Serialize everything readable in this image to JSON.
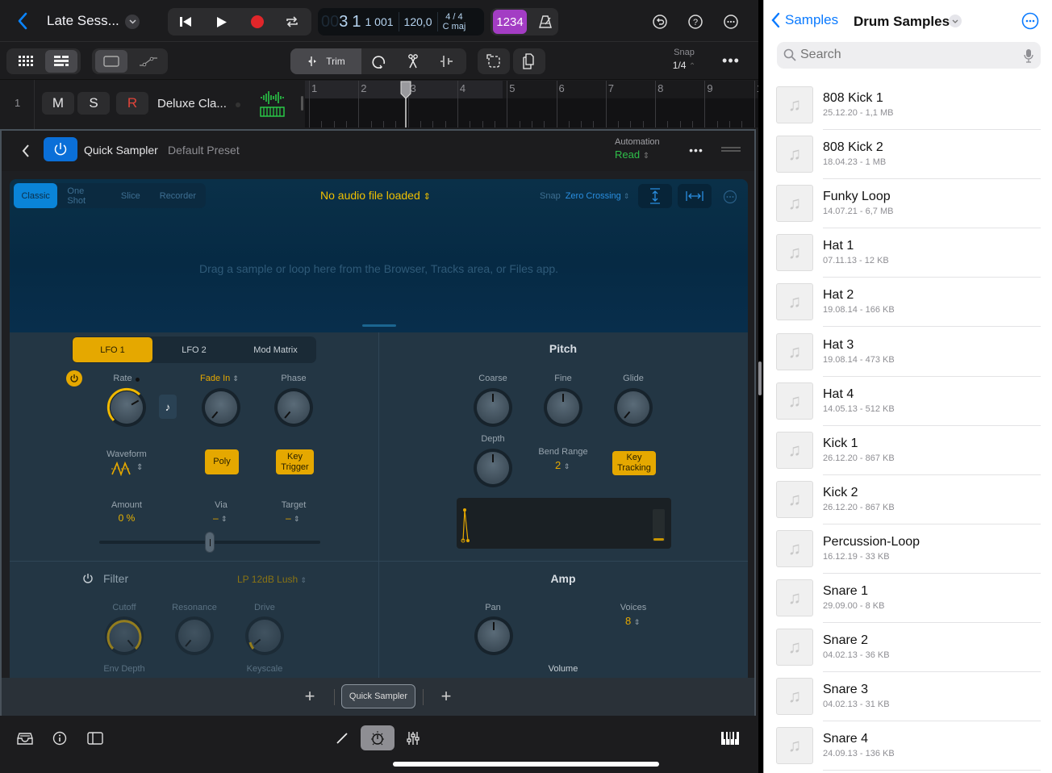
{
  "topbar": {
    "project_title": "Late Sess...",
    "lcd": {
      "position_dim": "00",
      "bar": "3",
      "beat": "1",
      "ticks": "1 001",
      "tempo": "120,0",
      "time_signature": "4 / 4",
      "key": "C maj"
    },
    "count_in_label": "1234",
    "accent_purple": "#a33dc4"
  },
  "toolbar": {
    "trim_label": "Trim",
    "snap_label": "Snap",
    "snap_value": "1/4"
  },
  "track": {
    "number": "1",
    "mute_label": "M",
    "solo_label": "S",
    "record_label": "R",
    "name": "Deluxe Cla...",
    "ruler_bars": [
      "1",
      "2",
      "3",
      "4",
      "5",
      "6",
      "7",
      "8",
      "9",
      "1"
    ],
    "playhead_bar": 2.95
  },
  "plugin": {
    "name": "Quick Sampler",
    "preset": "Default Preset",
    "automation_label": "Automation",
    "automation_value": "Read",
    "modes": [
      "Classic",
      "One Shot",
      "Slice",
      "Recorder"
    ],
    "active_mode": "Classic",
    "audio_file": "No audio file loaded",
    "snap_label": "Snap",
    "snap_value": "Zero Crossing",
    "drop_hint": "Drag a sample or loop here from the Browser, Tracks area, or Files app.",
    "mod_tabs": [
      "LFO 1",
      "LFO 2",
      "Mod Matrix"
    ],
    "active_mod_tab": "LFO 1",
    "lfo": {
      "rate_label": "Rate",
      "fade_label": "Fade In",
      "phase_label": "Phase",
      "waveform_label": "Waveform",
      "poly_label": "Poly",
      "key_trigger_label": "Key Trigger",
      "amount_label": "Amount",
      "amount_value": "0 %",
      "via_label": "Via",
      "via_value": "–",
      "target_label": "Target",
      "target_value": "–",
      "amount_slider": 0.5
    },
    "pitch": {
      "title": "Pitch",
      "coarse_label": "Coarse",
      "fine_label": "Fine",
      "glide_label": "Glide",
      "depth_label": "Depth",
      "bend_label": "Bend Range",
      "bend_value": "2",
      "key_tracking_label": "Key Tracking"
    },
    "filter": {
      "title": "Filter",
      "type": "LP 12dB Lush",
      "cutoff_label": "Cutoff",
      "resonance_label": "Resonance",
      "drive_label": "Drive",
      "env_depth_label": "Env Depth",
      "keyscale_label": "Keyscale"
    },
    "amp": {
      "title": "Amp",
      "pan_label": "Pan",
      "voices_label": "Voices",
      "voices_value": "8",
      "volume_label": "Volume"
    },
    "chain_slot": "Quick Sampler",
    "accent_yellow": "#e5a800",
    "accent_blue": "#0a84ff"
  },
  "files": {
    "back_label": "Samples",
    "title": "Drum Samples",
    "search_placeholder": "Search",
    "items": [
      {
        "name": "808 Kick 1",
        "meta": "25.12.20 - 1,1 MB"
      },
      {
        "name": "808 Kick 2",
        "meta": "18.04.23 - 1 MB"
      },
      {
        "name": "Funky Loop",
        "meta": "14.07.21 - 6,7 MB"
      },
      {
        "name": "Hat 1",
        "meta": "07.11.13 - 12 KB"
      },
      {
        "name": "Hat 2",
        "meta": "19.08.14 - 166 KB"
      },
      {
        "name": "Hat 3",
        "meta": "19.08.14 - 473 KB"
      },
      {
        "name": "Hat 4",
        "meta": "14.05.13 - 512 KB"
      },
      {
        "name": "Kick 1",
        "meta": "26.12.20 - 867 KB"
      },
      {
        "name": "Kick 2",
        "meta": "26.12.20 - 867 KB"
      },
      {
        "name": "Percussion-Loop",
        "meta": "16.12.19 - 33 KB"
      },
      {
        "name": "Snare 1",
        "meta": "29.09.00 - 8 KB"
      },
      {
        "name": "Snare 2",
        "meta": "04.02.13 - 36 KB"
      },
      {
        "name": "Snare 3",
        "meta": "04.02.13 - 31 KB"
      },
      {
        "name": "Snare 4",
        "meta": "24.09.13 - 136 KB"
      }
    ]
  }
}
